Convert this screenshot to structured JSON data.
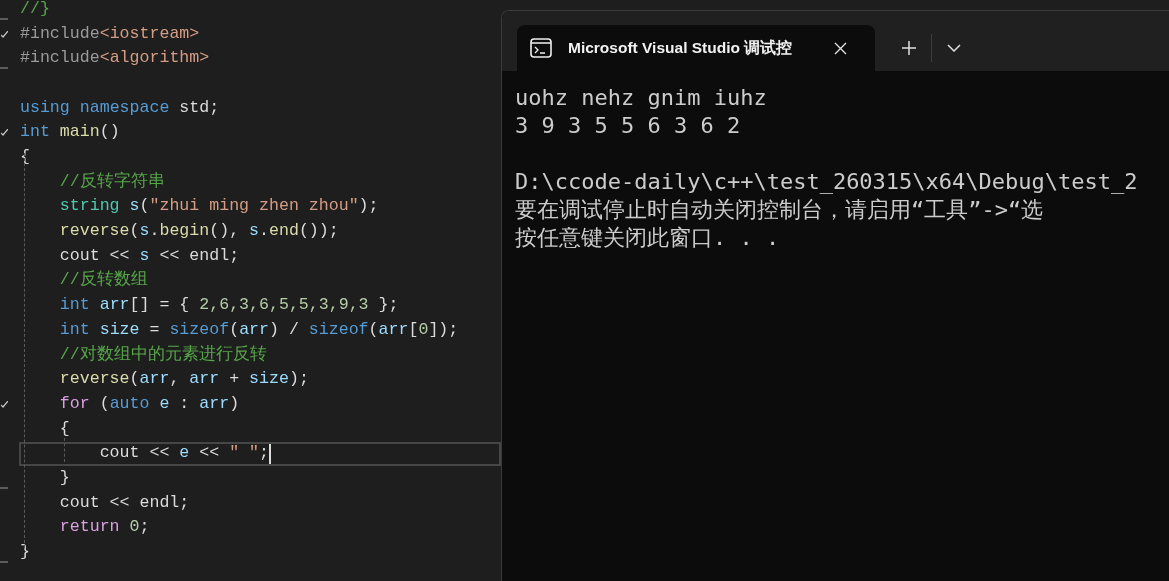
{
  "editor": {
    "lines": [
      {
        "current": false,
        "fold_start": false,
        "fold_end": true,
        "tokens": [
          {
            "kind": "comment",
            "text": "//}"
          }
        ]
      },
      {
        "current": false,
        "fold_start": true,
        "fold_end": false,
        "tokens": [
          {
            "kind": "pre",
            "text": "#include"
          },
          {
            "kind": "string",
            "text": "<iostream>"
          }
        ]
      },
      {
        "current": false,
        "fold_start": false,
        "fold_end": true,
        "tokens": [
          {
            "kind": "pre",
            "text": "#include"
          },
          {
            "kind": "string",
            "text": "<algorithm>"
          }
        ]
      },
      {
        "current": false,
        "fold_start": false,
        "fold_end": false
      },
      {
        "current": false,
        "fold_start": false,
        "fold_end": false,
        "tokens": [
          {
            "kind": "keyword",
            "text": "using"
          },
          {
            "kind": "keyword",
            "text": " namespace"
          },
          {
            "kind": "plain",
            "text": " std;"
          }
        ]
      },
      {
        "current": false,
        "fold_start": true,
        "fold_end": false,
        "tokens": [
          {
            "kind": "keyword",
            "text": "int"
          },
          {
            "kind": "func",
            "text": " main"
          },
          {
            "kind": "plain",
            "text": "()"
          }
        ]
      },
      {
        "current": false,
        "fold_start": false,
        "fold_end": false,
        "tokens": [
          {
            "kind": "plain",
            "text": "{"
          }
        ]
      },
      {
        "current": false,
        "fold_start": false,
        "fold_end": false,
        "tokens": [
          {
            "kind": "comment",
            "text": "    //反转字符串"
          }
        ]
      },
      {
        "current": false,
        "fold_start": false,
        "fold_end": false,
        "tokens": [
          {
            "kind": "type",
            "text": "    string"
          },
          {
            "kind": "var",
            "text": " s"
          },
          {
            "kind": "plain",
            "text": "("
          },
          {
            "kind": "string",
            "text": "\"zhui ming zhen zhou\""
          },
          {
            "kind": "plain",
            "text": ");"
          }
        ]
      },
      {
        "current": false,
        "fold_start": false,
        "fold_end": false,
        "tokens": [
          {
            "kind": "func",
            "text": "    reverse"
          },
          {
            "kind": "plain",
            "text": "("
          },
          {
            "kind": "var",
            "text": "s"
          },
          {
            "kind": "plain",
            "text": "."
          },
          {
            "kind": "func",
            "text": "begin"
          },
          {
            "kind": "plain",
            "text": "(),"
          },
          {
            "kind": "var",
            "text": " s"
          },
          {
            "kind": "plain",
            "text": "."
          },
          {
            "kind": "func",
            "text": "end"
          },
          {
            "kind": "plain",
            "text": "());"
          }
        ]
      },
      {
        "current": false,
        "fold_start": false,
        "fold_end": false,
        "tokens": [
          {
            "kind": "plain",
            "text": "    cout <<"
          },
          {
            "kind": "var",
            "text": " s"
          },
          {
            "kind": "plain",
            "text": " << endl;"
          }
        ]
      },
      {
        "current": false,
        "fold_start": false,
        "fold_end": false,
        "tokens": [
          {
            "kind": "comment",
            "text": "    //反转数组"
          }
        ]
      },
      {
        "current": false,
        "fold_start": false,
        "fold_end": false,
        "tokens": [
          {
            "kind": "keyword",
            "text": "    int"
          },
          {
            "kind": "var",
            "text": " arr"
          },
          {
            "kind": "plain",
            "text": "[] = {"
          },
          {
            "kind": "number",
            "text": " 2,6,3,6,5,5,3,9,3"
          },
          {
            "kind": "plain",
            "text": " };"
          }
        ]
      },
      {
        "current": false,
        "fold_start": false,
        "fold_end": false,
        "tokens": [
          {
            "kind": "keyword",
            "text": "    int"
          },
          {
            "kind": "var",
            "text": " size"
          },
          {
            "kind": "plain",
            "text": " ="
          },
          {
            "kind": "keyword",
            "text": " sizeof"
          },
          {
            "kind": "plain",
            "text": "("
          },
          {
            "kind": "var",
            "text": "arr"
          },
          {
            "kind": "plain",
            "text": ") /"
          },
          {
            "kind": "keyword",
            "text": " sizeof"
          },
          {
            "kind": "plain",
            "text": "("
          },
          {
            "kind": "var",
            "text": "arr"
          },
          {
            "kind": "plain",
            "text": "["
          },
          {
            "kind": "number",
            "text": "0"
          },
          {
            "kind": "plain",
            "text": "]);"
          }
        ]
      },
      {
        "current": false,
        "fold_start": false,
        "fold_end": false,
        "tokens": [
          {
            "kind": "comment",
            "text": "    //对数组中的元素进行反转"
          }
        ]
      },
      {
        "current": false,
        "fold_start": false,
        "fold_end": false,
        "tokens": [
          {
            "kind": "func",
            "text": "    reverse"
          },
          {
            "kind": "plain",
            "text": "("
          },
          {
            "kind": "var",
            "text": "arr"
          },
          {
            "kind": "plain",
            "text": ","
          },
          {
            "kind": "var",
            "text": " arr"
          },
          {
            "kind": "plain",
            "text": " +"
          },
          {
            "kind": "var",
            "text": " size"
          },
          {
            "kind": "plain",
            "text": ");"
          }
        ]
      },
      {
        "current": false,
        "fold_start": true,
        "fold_end": false,
        "tokens": [
          {
            "kind": "control",
            "text": "    for"
          },
          {
            "kind": "plain",
            "text": " ("
          },
          {
            "kind": "keyword",
            "text": "auto"
          },
          {
            "kind": "var",
            "text": " e"
          },
          {
            "kind": "plain",
            "text": " :"
          },
          {
            "kind": "var",
            "text": " arr"
          },
          {
            "kind": "plain",
            "text": ")"
          }
        ]
      },
      {
        "current": false,
        "fold_start": false,
        "fold_end": false,
        "tokens": [
          {
            "kind": "plain",
            "text": "    {"
          }
        ]
      },
      {
        "current": true,
        "fold_start": false,
        "fold_end": false,
        "tokens": [
          {
            "kind": "plain",
            "text": "        cout <<"
          },
          {
            "kind": "var",
            "text": " e"
          },
          {
            "kind": "plain",
            "text": " <<"
          },
          {
            "kind": "string",
            "text": " \" \""
          },
          {
            "kind": "plain",
            "text": ";"
          }
        ]
      },
      {
        "current": false,
        "fold_start": false,
        "fold_end": true,
        "tokens": [
          {
            "kind": "plain",
            "text": "    }"
          }
        ]
      },
      {
        "current": false,
        "fold_start": false,
        "fold_end": false,
        "tokens": [
          {
            "kind": "plain",
            "text": "    cout << endl;"
          }
        ]
      },
      {
        "current": false,
        "fold_start": false,
        "fold_end": false,
        "tokens": [
          {
            "kind": "control",
            "text": "    return"
          },
          {
            "kind": "number",
            "text": " 0"
          },
          {
            "kind": "plain",
            "text": ";"
          }
        ]
      },
      {
        "current": false,
        "fold_start": false,
        "fold_end": true,
        "tokens": [
          {
            "kind": "plain",
            "text": "}"
          }
        ]
      }
    ]
  },
  "terminal": {
    "tab": {
      "title": "Microsoft Visual Studio 调试控",
      "selected": true
    },
    "output": [
      "uohz nehz gnim iuhz",
      "3 9 3 5 5 6 3 6 2",
      "D:\\ccode-daily\\c++\\test_260315\\x64\\Debug\\test_2",
      "要在调试停止时自动关闭控制台，请启用“工具”->“选",
      "按任意键关闭此窗口. . ."
    ]
  }
}
